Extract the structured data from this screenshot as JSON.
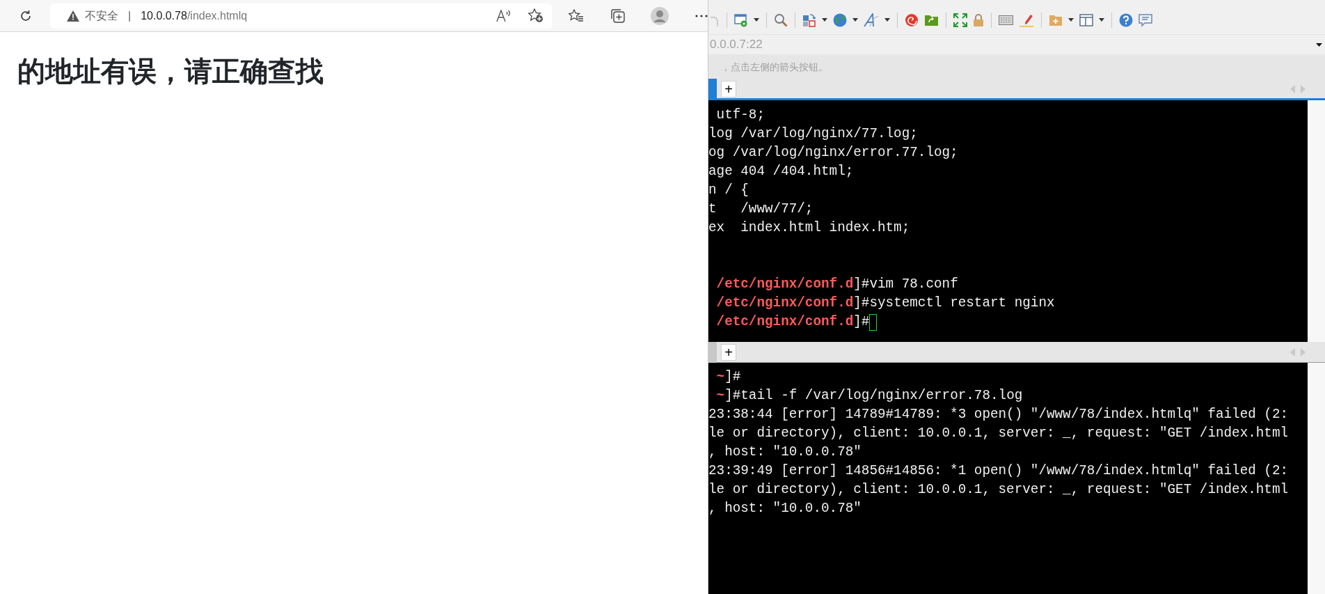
{
  "browser": {
    "address": {
      "security_label": "不安全",
      "separator": "|",
      "host": "10.0.0.78",
      "path": "/index.htmlq"
    },
    "page": {
      "heading": "的地址有误，请正确查找"
    }
  },
  "ssh_client": {
    "address_field": {
      "value": "0.0.0.7:22"
    },
    "hint": "，点击左侧的箭头按钮。",
    "terminals": [
      {
        "tab_selected": true,
        "new_tab": "+",
        "blocks": [
          {
            "lines": [
              {
                "text": " utf-8;"
              },
              {
                "text": "log /var/log/nginx/77.log;"
              },
              {
                "text": "og /var/log/nginx/error.77.log;"
              },
              {
                "text": "age 404 /404.html;"
              },
              {
                "text": "n / {"
              },
              {
                "text": "t   /www/77/;"
              },
              {
                "text": "ex  index.html index.htm;"
              }
            ]
          },
          {
            "lines": [
              {
                "prompt": " /etc/nginx/conf.d",
                "text": "]#vim 78.conf",
                "cursor": false
              },
              {
                "prompt": " /etc/nginx/conf.d",
                "text": "]#systemctl restart nginx",
                "cursor": false
              },
              {
                "prompt": " /etc/nginx/conf.d",
                "text": "]#",
                "cursor": true
              }
            ]
          }
        ]
      },
      {
        "tab_selected": false,
        "new_tab": "+",
        "blocks": [
          {
            "lines": [
              {
                "prompt": " ~",
                "text": "]#",
                "cursor": false
              },
              {
                "prompt": " ~",
                "text": "]#tail -f /var/log/nginx/error.78.log",
                "cursor": false
              },
              {
                "text": "23:38:44 [error] 14789#14789: *3 open() \"/www/78/index.htmlq\" failed (2:"
              },
              {
                "text": "le or directory), client: 10.0.0.1, server: _, request: \"GET /index.html"
              },
              {
                "text": ", host: \"10.0.0.78\""
              },
              {
                "text": "23:39:49 [error] 14856#14856: *1 open() \"/www/78/index.htmlq\" failed (2:"
              },
              {
                "text": "le or directory), client: 10.0.0.1, server: _, request: \"GET /index.html"
              },
              {
                "text": ", host: \"10.0.0.78\""
              }
            ]
          }
        ]
      }
    ]
  }
}
